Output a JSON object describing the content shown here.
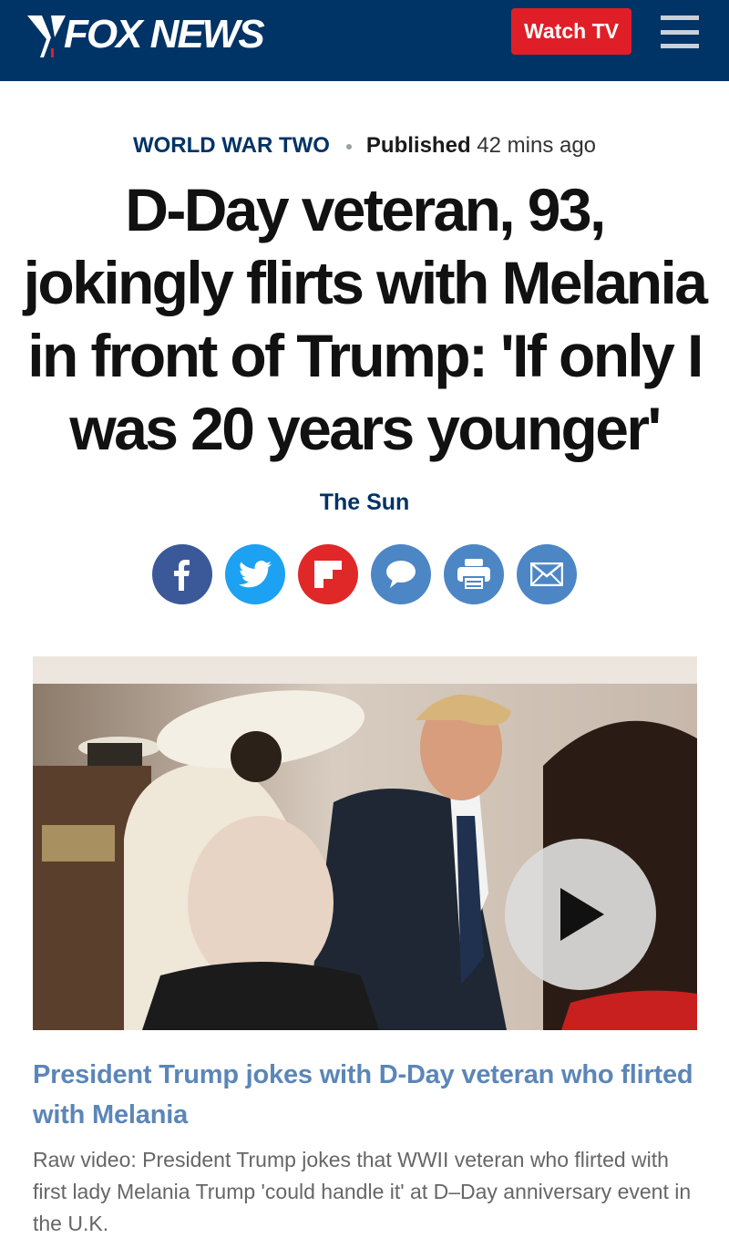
{
  "header": {
    "logo_text": "FOX NEWS",
    "watch_label": "Watch TV",
    "brand_color": "#003366",
    "accent_color": "#e01e27"
  },
  "article": {
    "category": "WORLD WAR TWO",
    "published_label": "Published",
    "published_time": "42 mins ago",
    "headline": "D-Day veteran, 93, jokingly flirts with Melania in front of Trump: 'If only I was 20 years younger'",
    "source": "The Sun"
  },
  "share_icons": [
    "facebook-icon",
    "twitter-icon",
    "flipboard-icon",
    "comment-icon",
    "print-icon",
    "email-icon"
  ],
  "video": {
    "title": "President Trump jokes with D-Day veteran who flirted with Melania",
    "description": "Raw video: President Trump jokes that WWII veteran who flirted with first lady Melania Trump 'could handle it' at D–Day anniversary event in the U.K."
  }
}
